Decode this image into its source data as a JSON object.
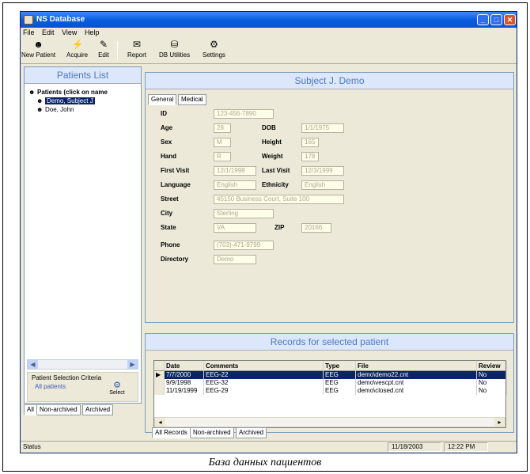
{
  "window": {
    "title": "NS Database",
    "buttons": {
      "minimize": "_",
      "maximize": "□",
      "close": "✕"
    }
  },
  "menu": [
    "File",
    "Edit",
    "View",
    "Help"
  ],
  "toolbar": [
    {
      "label": "New Patient",
      "icon": "new-patient-icon",
      "glyph": "☻"
    },
    {
      "label": "Acquire",
      "icon": "acquire-icon",
      "glyph": "⚡"
    },
    {
      "label": "Edit",
      "icon": "edit-icon",
      "glyph": "✎"
    },
    {
      "label": "Report",
      "icon": "report-icon",
      "glyph": "✉"
    },
    {
      "label": "DB Utilities",
      "icon": "db-utilities-icon",
      "glyph": "⛁"
    },
    {
      "label": "Settings",
      "icon": "settings-icon",
      "glyph": "⚙"
    }
  ],
  "patients_list": {
    "title": "Patients List",
    "root": "Patients (click on name",
    "patients": [
      "Demo, Subject J",
      "Doe, John"
    ],
    "selected": 0,
    "criteria": {
      "label": "Patient Selection Criteria",
      "value": "All patients",
      "select_button": "Select"
    },
    "tabs": [
      "All",
      "Non-archived",
      "Archived"
    ]
  },
  "subject": {
    "title": "Subject J. Demo",
    "tabs": [
      "General",
      "Medical"
    ],
    "fields": {
      "id": {
        "label": "ID",
        "value": "123-456-7890"
      },
      "age": {
        "label": "Age",
        "value": "28"
      },
      "dob": {
        "label": "DOB",
        "value": "1/1/1975"
      },
      "sex": {
        "label": "Sex",
        "value": "M"
      },
      "height": {
        "label": "Height",
        "value": "165"
      },
      "hand": {
        "label": "Hand",
        "value": "R"
      },
      "weight": {
        "label": "Weight",
        "value": "178"
      },
      "first_visit": {
        "label": "First Visit",
        "value": "12/1/1998"
      },
      "last_visit": {
        "label": "Last Visit",
        "value": "12/3/1999"
      },
      "language": {
        "label": "Language",
        "value": "English"
      },
      "ethnicity": {
        "label": "Ethnicity",
        "value": "English"
      },
      "street": {
        "label": "Street",
        "value": "45150 Business Court, Suite 100"
      },
      "city": {
        "label": "City",
        "value": "Sterling"
      },
      "state": {
        "label": "State",
        "value": "VA"
      },
      "zip": {
        "label": "ZIP",
        "value": "20166"
      },
      "phone": {
        "label": "Phone",
        "value": "(703)-471-9799"
      },
      "directory": {
        "label": "Directory",
        "value": "Demo"
      }
    }
  },
  "records": {
    "title": "Records for selected patient",
    "columns": [
      "Date",
      "Comments",
      "Type",
      "File",
      "Review"
    ],
    "rows": [
      [
        "7/7/2000",
        "EEG-22",
        "EEG",
        "demo\\demo22.cnt",
        "No"
      ],
      [
        "9/9/1998",
        "EEG-32",
        "EEG",
        "demo\\vescpt.cnt",
        "No"
      ],
      [
        "11/19/1999",
        "EEG-29",
        "EEG",
        "demo\\closed.cnt",
        "No"
      ]
    ],
    "selected": 0,
    "tabs": [
      "All Records",
      "Non-archived",
      "Archived"
    ]
  },
  "status": {
    "text": "Status",
    "date": "11/18/2003",
    "time": "12:22 PM"
  },
  "caption": "База данных пациентов"
}
